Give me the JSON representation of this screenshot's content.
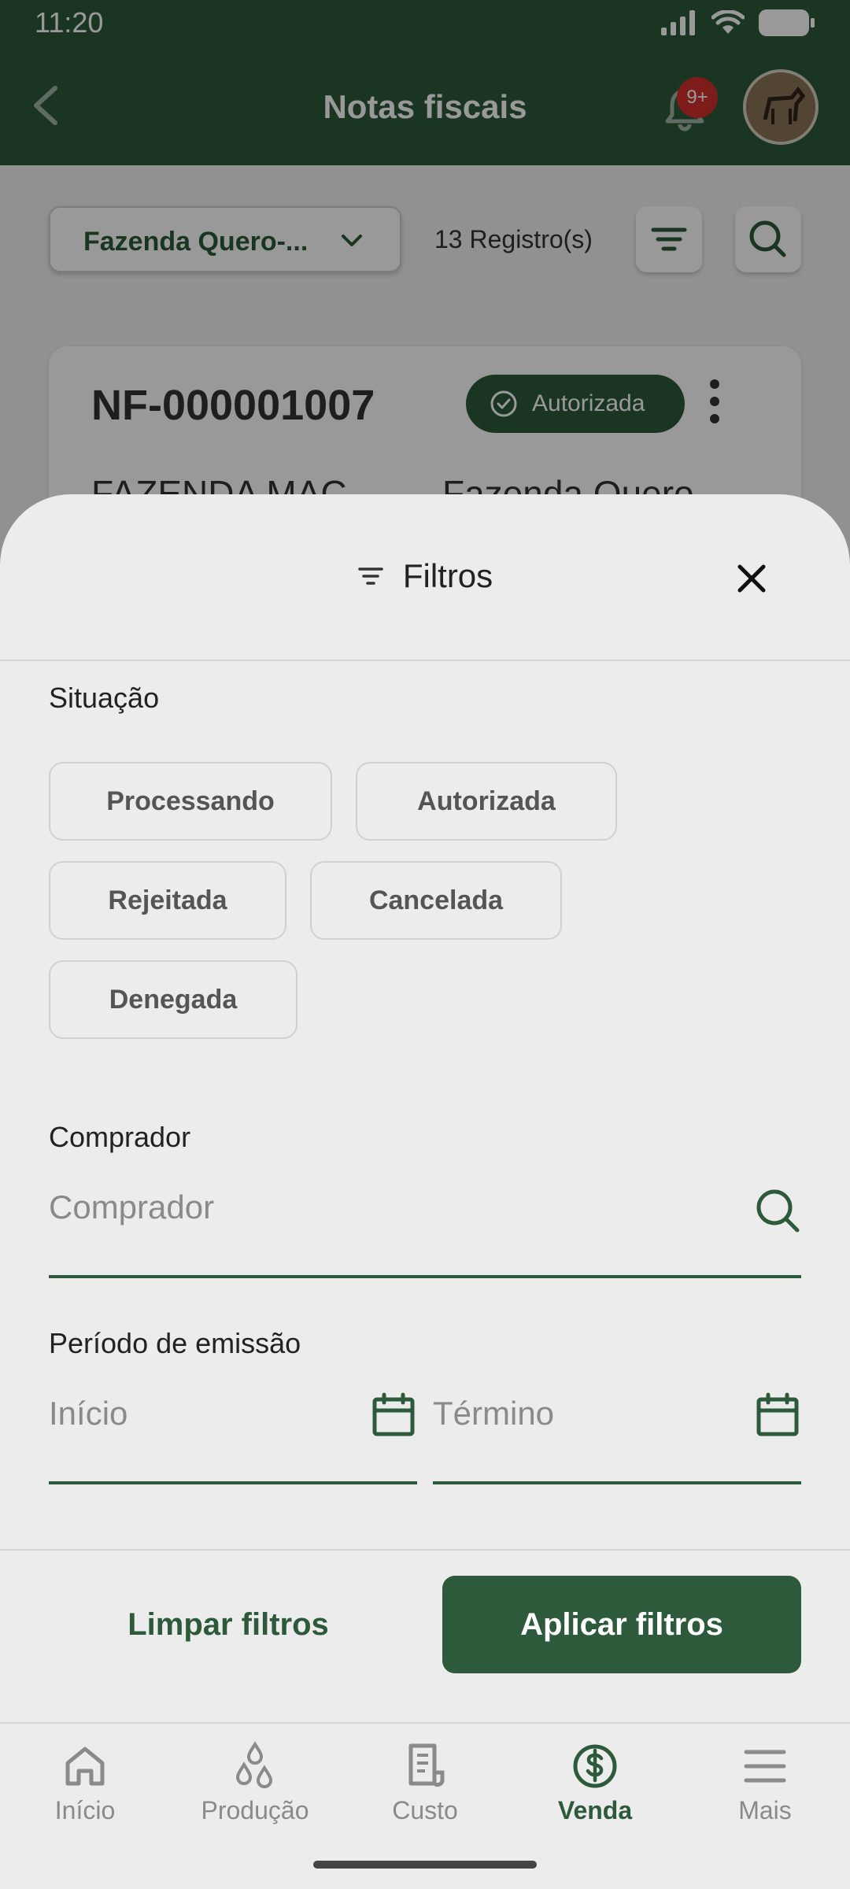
{
  "status_bar": {
    "time": "11:20"
  },
  "header": {
    "title": "Notas fiscais",
    "notification_badge": "9+"
  },
  "toolbar": {
    "farm_select_label": "Fazenda Quero-...",
    "record_count": "13 Registro(s)"
  },
  "card": {
    "number": "NF-000001007",
    "status": "Autorizada",
    "buyer": "FAZENDA MAC",
    "farm": "Fazenda Quero-"
  },
  "filters_sheet": {
    "title": "Filtros",
    "situacao": {
      "label": "Situação",
      "options": [
        "Processando",
        "Autorizada",
        "Rejeitada",
        "Cancelada",
        "Denegada"
      ]
    },
    "comprador": {
      "label": "Comprador",
      "placeholder": "Comprador"
    },
    "periodo": {
      "label": "Período de emissão",
      "start_placeholder": "Início",
      "end_placeholder": "Término"
    },
    "clear_label": "Limpar filtros",
    "apply_label": "Aplicar filtros"
  },
  "bottom_nav": {
    "items": [
      {
        "label": "Início",
        "icon": "home-icon"
      },
      {
        "label": "Produção",
        "icon": "drops-icon"
      },
      {
        "label": "Custo",
        "icon": "receipt-icon"
      },
      {
        "label": "Venda",
        "icon": "dollar-circle-icon",
        "active": true
      },
      {
        "label": "Mais",
        "icon": "menu-icon"
      }
    ]
  },
  "colors": {
    "primary": "#2c5a3a",
    "badge": "#d32f2f",
    "sheet_background": "#ececec"
  }
}
